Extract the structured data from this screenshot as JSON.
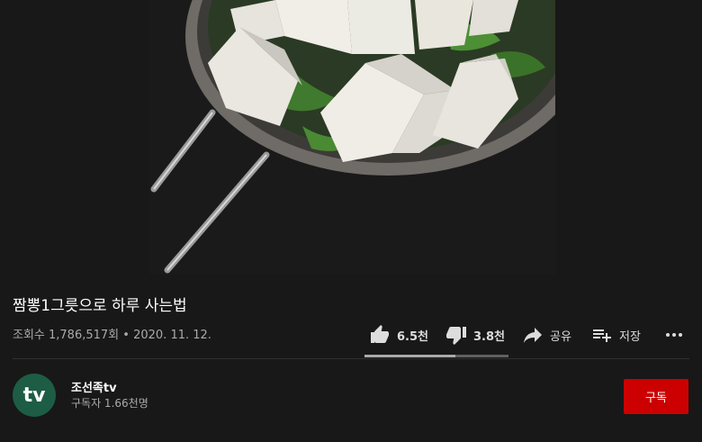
{
  "video": {
    "title": "짬뽕1그릇으로 하루 사는법",
    "views": "조회수 1,786,517회",
    "separator": "•",
    "date": "2020. 11. 12."
  },
  "actions": {
    "like_count": "6.5천",
    "dislike_count": "3.8천",
    "share_label": "공유",
    "save_label": "저장",
    "like_ratio": 0.63
  },
  "channel": {
    "avatar_text": "tv",
    "name": "조선족tv",
    "subscribers": "구독자 1.66천명",
    "subscribe_label": "구독"
  },
  "colors": {
    "background": "#181818",
    "subscribe": "#cc0000",
    "avatar": "#1d5d45"
  },
  "icons": {
    "like": "thumbs-up-icon",
    "dislike": "thumbs-down-icon",
    "share": "share-arrow-icon",
    "save": "playlist-add-icon",
    "more": "more-horizontal-icon"
  }
}
